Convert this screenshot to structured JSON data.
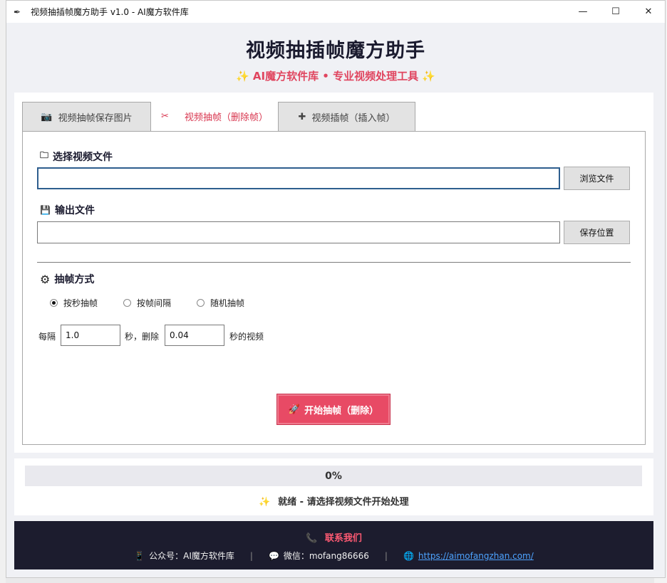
{
  "window": {
    "title": "视频抽插帧魔方助手 v1.0 - AI魔方软件库",
    "app_icon": "feather-icon"
  },
  "header": {
    "title": "视频抽插帧魔方助手",
    "subtitle": "✨ AI魔方软件库 • 专业视频处理工具 ✨"
  },
  "tabs": [
    {
      "icon": "📷",
      "label": "视频抽帧保存图片",
      "active": false
    },
    {
      "icon": "✂",
      "label": "视频抽帧（删除帧）",
      "active": true
    },
    {
      "icon": "✚",
      "label": "视频插帧（插入帧）",
      "active": false
    }
  ],
  "input_section": {
    "icon": "🗀",
    "label": "选择视频文件",
    "value": "",
    "browse_label": "浏览文件"
  },
  "output_section": {
    "icon": "💾",
    "label": "输出文件",
    "value": "",
    "save_label": "保存位置"
  },
  "method_section": {
    "icon": "⚙",
    "label": "抽帧方式",
    "options": [
      {
        "label": "按秒抽帧",
        "checked": true
      },
      {
        "label": "按帧间隔",
        "checked": false
      },
      {
        "label": "随机抽帧",
        "checked": false
      }
    ]
  },
  "params": {
    "prefix": "每隔",
    "interval_value": "1.0",
    "middle": "秒，删除",
    "delete_value": "0.04",
    "suffix": "秒的视频"
  },
  "start_button": {
    "icon": "🚀",
    "label": "开始抽帧（删除）"
  },
  "progress": {
    "percent": 0,
    "text": "0%",
    "status_icon": "✨",
    "status": "就绪 - 请选择视频文件开始处理"
  },
  "footer": {
    "contact_icon": "📞",
    "contact_title": "联系我们",
    "wechat_official": {
      "icon": "📱",
      "text": "公众号：AI魔方软件库"
    },
    "wechat": {
      "icon": "💬",
      "text": "微信：mofang86666"
    },
    "website": {
      "icon": "🌐",
      "text": "https://aimofangzhan.com/"
    },
    "separator": "|"
  }
}
